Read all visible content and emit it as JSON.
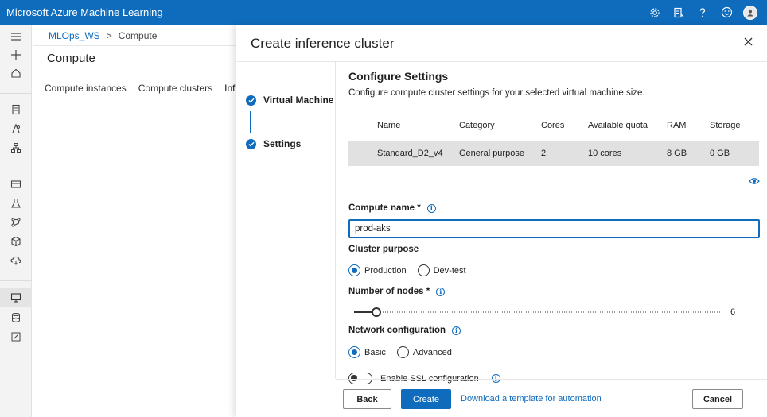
{
  "app": {
    "title": "Microsoft Azure Machine Learning"
  },
  "topbar": {
    "icons": [
      "gear-icon",
      "notes-icon",
      "help-icon",
      "feedback-icon",
      "avatar"
    ]
  },
  "breadcrumb": {
    "workspace": "MLOps_WS",
    "separator": ">",
    "current": "Compute"
  },
  "page": {
    "title": "Compute",
    "tabs": [
      "Compute instances",
      "Compute clusters",
      "Infere"
    ]
  },
  "panel": {
    "title": "Create inference cluster",
    "steps": [
      {
        "label": "Virtual Machine",
        "done": true
      },
      {
        "label": "Settings",
        "done": true
      }
    ],
    "section_title": "Configure Settings",
    "section_desc": "Configure compute cluster settings for your selected virtual machine size.",
    "table": {
      "headers": [
        "Name",
        "Category",
        "Cores",
        "Available quota",
        "RAM",
        "Storage"
      ],
      "row": [
        "Standard_D2_v4",
        "General purpose",
        "2",
        "10 cores",
        "8 GB",
        "0 GB"
      ]
    },
    "compute_name": {
      "label": "Compute name",
      "required": "*",
      "value": "prod-aks"
    },
    "cluster_purpose": {
      "label": "Cluster purpose",
      "options": [
        "Production",
        "Dev-test"
      ],
      "selected": "Production"
    },
    "nodes": {
      "label": "Number of nodes",
      "required": "*",
      "value": 6,
      "display": "6",
      "fraction": 0.06
    },
    "network": {
      "label": "Network configuration",
      "options": [
        "Basic",
        "Advanced"
      ],
      "selected": "Basic"
    },
    "ssl": {
      "label": "Enable SSL configuration",
      "enabled": false
    }
  },
  "footer": {
    "back": "Back",
    "create": "Create",
    "template_link": "Download a template for automation",
    "cancel": "Cancel"
  },
  "colors": {
    "accent": "#0f6cbd",
    "row_bg": "#e1e1e1"
  }
}
